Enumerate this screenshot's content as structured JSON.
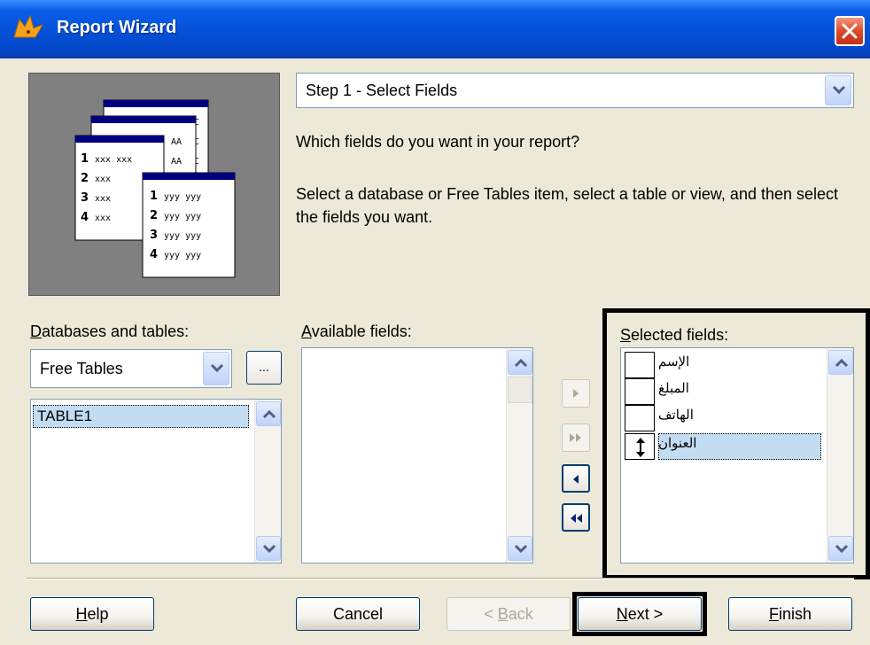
{
  "window": {
    "title": "Report Wizard"
  },
  "step": {
    "selected": "Step 1 - Select Fields",
    "question": "Which fields do you want in your report?",
    "instructions": "Select a database or Free Tables item, select a table or view, and then select the fields you want."
  },
  "illustration": {
    "left_table_rows": [
      {
        "num": "1",
        "text": "xxx xxx"
      },
      {
        "num": "2",
        "text": "xxx"
      },
      {
        "num": "3",
        "text": "xxx"
      },
      {
        "num": "4",
        "text": "xxx"
      }
    ],
    "right_table_rows": [
      {
        "num": "1",
        "text": "yyy yyy"
      },
      {
        "num": "2",
        "text": "yyy yyy"
      },
      {
        "num": "3",
        "text": "yyy yyy"
      },
      {
        "num": "4",
        "text": "yyy yyy"
      }
    ],
    "back_labels": [
      "AA",
      "AA",
      "C",
      "C",
      "C"
    ]
  },
  "databases": {
    "label_accel": "D",
    "label_rest": "atabases and tables:",
    "combo_value": "Free Tables",
    "browse_label": "...",
    "tables": [
      "TABLE1"
    ]
  },
  "available": {
    "label_accel": "A",
    "label_rest": "vailable fields:",
    "items": []
  },
  "selected": {
    "label_accel": "S",
    "label_rest": "elected fields:",
    "items": [
      "الإسم",
      "المبلغ",
      "الهاتف",
      "العنوان"
    ]
  },
  "buttons": {
    "help_accel": "H",
    "help_rest": "elp",
    "cancel": "Cancel",
    "back_prefix": "< ",
    "back_accel": "B",
    "back_rest": "ack",
    "next_accel": "N",
    "next_rest": "ext >",
    "finish_accel": "F",
    "finish_rest": "inish"
  },
  "colors": {
    "title_bar": "#0552d9",
    "selection": "#c2dcf2",
    "dialog_bg": "#ece9d8",
    "close": "#e04a2a"
  }
}
